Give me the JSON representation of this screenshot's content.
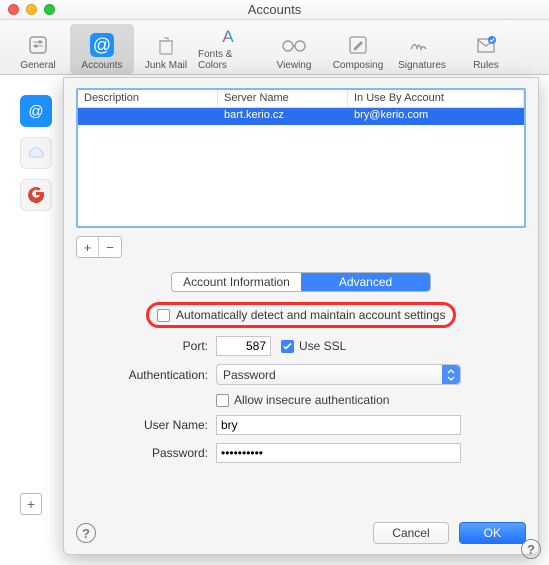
{
  "window": {
    "title": "Accounts"
  },
  "toolbar": [
    {
      "id": "general",
      "label": "General"
    },
    {
      "id": "accounts",
      "label": "Accounts"
    },
    {
      "id": "junkmail",
      "label": "Junk Mail"
    },
    {
      "id": "fontscolors",
      "label": "Fonts & Colors"
    },
    {
      "id": "viewing",
      "label": "Viewing"
    },
    {
      "id": "composing",
      "label": "Composing"
    },
    {
      "id": "signatures",
      "label": "Signatures"
    },
    {
      "id": "rules",
      "label": "Rules"
    }
  ],
  "table": {
    "headers": {
      "desc": "Description",
      "server": "Server Name",
      "inuse": "In Use By Account"
    },
    "row": {
      "desc": "",
      "server": "bart.kerio.cz",
      "inuse": "bry@kerio.com"
    }
  },
  "tabs": {
    "info": "Account Information",
    "advanced": "Advanced"
  },
  "form": {
    "autodetect_label": "Automatically detect and maintain account settings",
    "port_label": "Port:",
    "port_value": "587",
    "usessl_label": "Use SSL",
    "auth_label": "Authentication:",
    "auth_value": "Password",
    "insecure_label": "Allow insecure authentication",
    "username_label": "User Name:",
    "username_value": "bry",
    "password_label": "Password:",
    "password_value": "••••••••••"
  },
  "buttons": {
    "cancel": "Cancel",
    "ok": "OK"
  }
}
